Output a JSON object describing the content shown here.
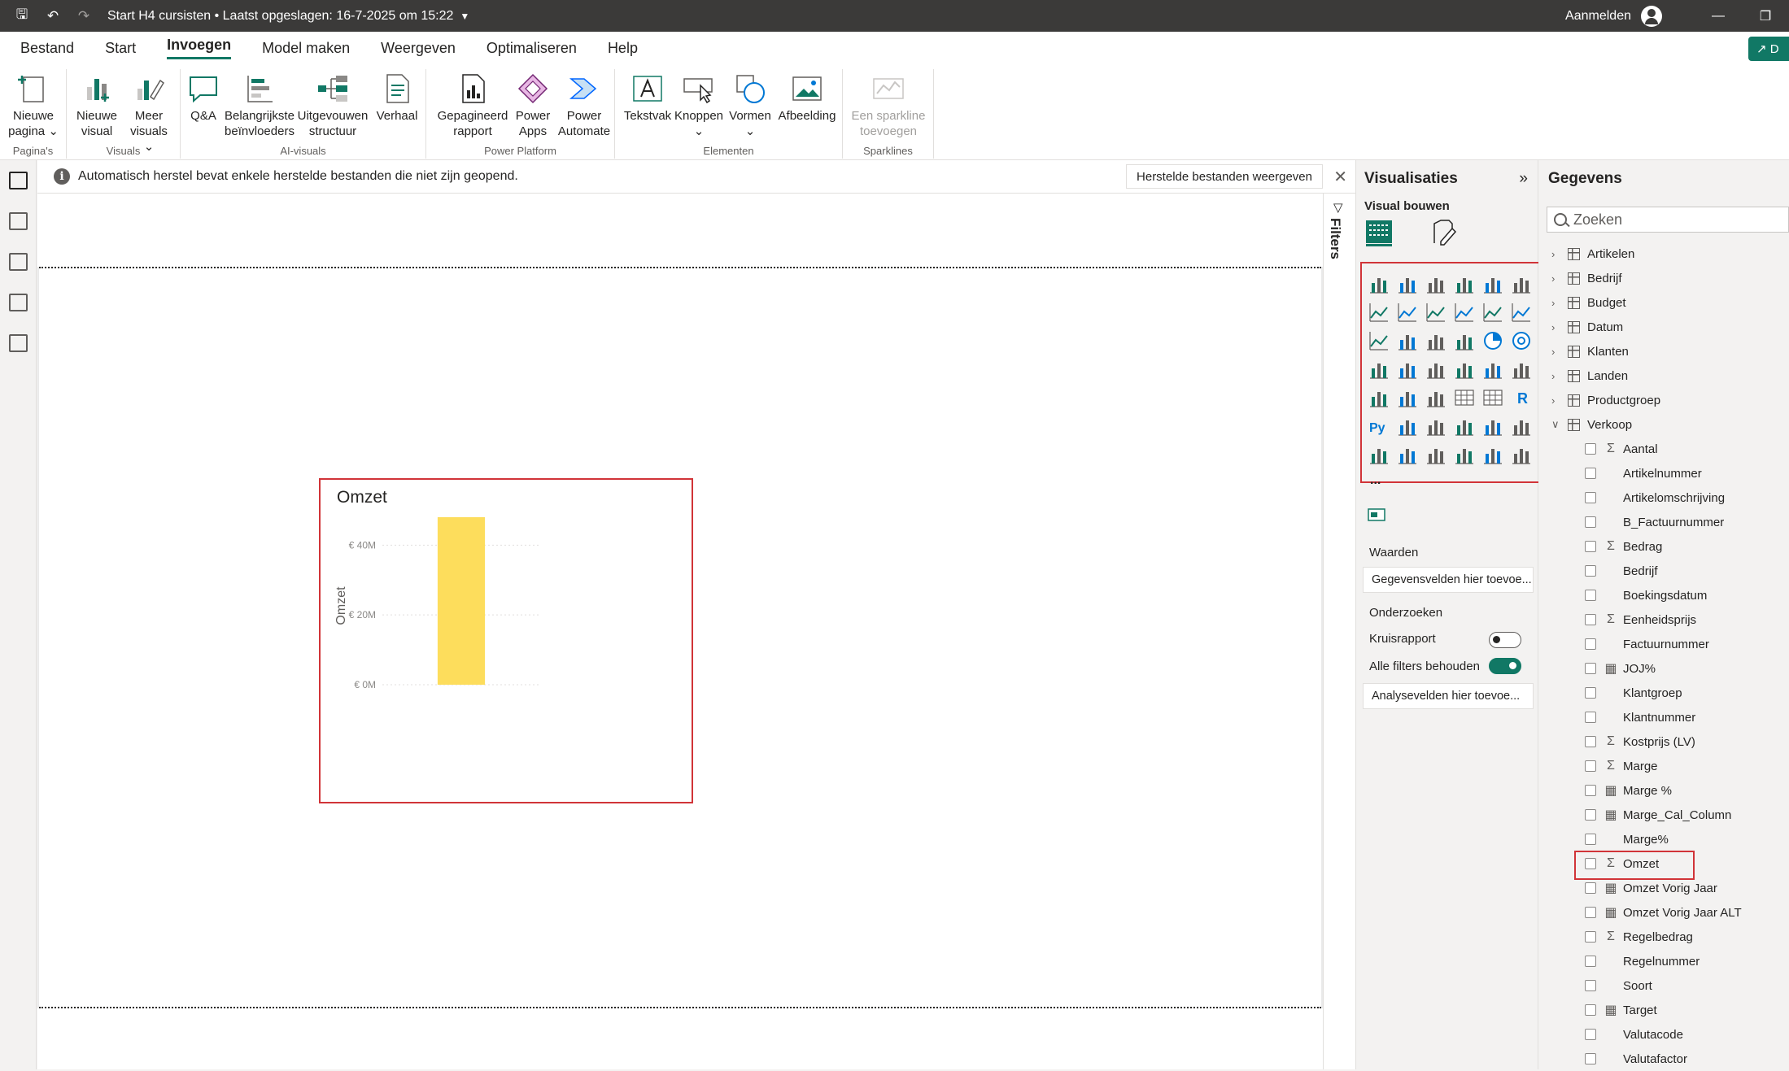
{
  "titlebar": {
    "title": "Start H4 cursisten • Laatst opgeslagen: 16-7-2025 om 15:22",
    "signin": "Aanmelden"
  },
  "menu": [
    "Bestand",
    "Start",
    "Invoegen",
    "Model maken",
    "Weergeven",
    "Optimaliseren",
    "Help"
  ],
  "share_label": "D",
  "ribbon": {
    "groups": [
      {
        "label": "Pagina's",
        "buttons": [
          [
            "Nieuwe",
            "pagina ⌄"
          ]
        ]
      },
      {
        "label": "Visuals",
        "buttons": [
          [
            "Nieuwe",
            "visual"
          ],
          [
            "Meer",
            "visuals ⌄"
          ]
        ]
      },
      {
        "label": "AI-visuals",
        "buttons": [
          [
            "Q&A",
            ""
          ],
          [
            "Belangrijkste",
            "beïnvloeders"
          ],
          [
            "Uitgevouwen",
            "structuur"
          ],
          [
            "Verhaal",
            ""
          ]
        ]
      },
      {
        "label": "Power Platform",
        "buttons": [
          [
            "Gepagineerd",
            "rapport"
          ],
          [
            "Power",
            "Apps"
          ],
          [
            "Power",
            "Automate"
          ]
        ]
      },
      {
        "label": "Elementen",
        "buttons": [
          [
            "Tekstvak",
            ""
          ],
          [
            "Knoppen",
            "⌄"
          ],
          [
            "Vormen",
            "⌄"
          ],
          [
            "Afbeelding",
            ""
          ]
        ]
      },
      {
        "label": "Sparklines",
        "buttons": [
          [
            "Een sparkline",
            "toevoegen"
          ]
        ]
      }
    ]
  },
  "banner": {
    "message": "Automatisch herstel bevat enkele herstelde bestanden die niet zijn geopend.",
    "button": "Herstelde bestanden weergeven"
  },
  "filters_label": "Filters",
  "visual": {
    "title": "Omzet"
  },
  "chart_data": {
    "type": "bar",
    "title": "Omzet",
    "ylabel": "Omzet",
    "categories": [
      ""
    ],
    "values": [
      48
    ],
    "ylim": [
      0,
      48
    ],
    "yticks": [
      "€ 0M",
      "€ 20M",
      "€ 40M"
    ],
    "ytick_values": [
      0,
      20,
      40
    ],
    "bar_color": "#fddd5c",
    "grid": true
  },
  "viz_pane": {
    "title": "Visualisaties",
    "subtitle": "Visual bouwen",
    "values_label": "Waarden",
    "values_drop": "Gegevensvelden hier toevoe...",
    "drill_label": "Onderzoeken",
    "cross_label": "Kruisrapport",
    "keep_filters_label": "Alle filters behouden",
    "analysis_drop": "Analysevelden hier toevoe...",
    "more": "..."
  },
  "data_pane": {
    "title": "Gegevens",
    "search_placeholder": "Zoeken",
    "tables": [
      "Artikelen",
      "Bedrijf",
      "Budget",
      "Datum",
      "Klanten",
      "Landen",
      "Productgroep",
      "Verkoop"
    ],
    "fields": [
      {
        "name": "Aantal",
        "icon": "sigma"
      },
      {
        "name": "Artikelnummer",
        "icon": ""
      },
      {
        "name": "Artikelomschrijving",
        "icon": ""
      },
      {
        "name": "B_Factuurnummer",
        "icon": ""
      },
      {
        "name": "Bedrag",
        "icon": "sigma"
      },
      {
        "name": "Bedrijf",
        "icon": ""
      },
      {
        "name": "Boekingsdatum",
        "icon": ""
      },
      {
        "name": "Eenheidsprijs",
        "icon": "sigma"
      },
      {
        "name": "Factuurnummer",
        "icon": ""
      },
      {
        "name": "JOJ%",
        "icon": "calc"
      },
      {
        "name": "Klantgroep",
        "icon": ""
      },
      {
        "name": "Klantnummer",
        "icon": ""
      },
      {
        "name": "Kostprijs (LV)",
        "icon": "sigma"
      },
      {
        "name": "Marge",
        "icon": "sigma"
      },
      {
        "name": "Marge %",
        "icon": "calc"
      },
      {
        "name": "Marge_Cal_Column",
        "icon": "calc"
      },
      {
        "name": "Marge%",
        "icon": ""
      },
      {
        "name": "Omzet",
        "icon": "sigma"
      },
      {
        "name": "Omzet Vorig Jaar",
        "icon": "calc"
      },
      {
        "name": "Omzet Vorig Jaar ALT",
        "icon": "calc"
      },
      {
        "name": "Regelbedrag",
        "icon": "sigma"
      },
      {
        "name": "Regelnummer",
        "icon": ""
      },
      {
        "name": "Soort",
        "icon": ""
      },
      {
        "name": "Target",
        "icon": "calc"
      },
      {
        "name": "Valutacode",
        "icon": ""
      },
      {
        "name": "Valutafactor",
        "icon": ""
      }
    ]
  }
}
